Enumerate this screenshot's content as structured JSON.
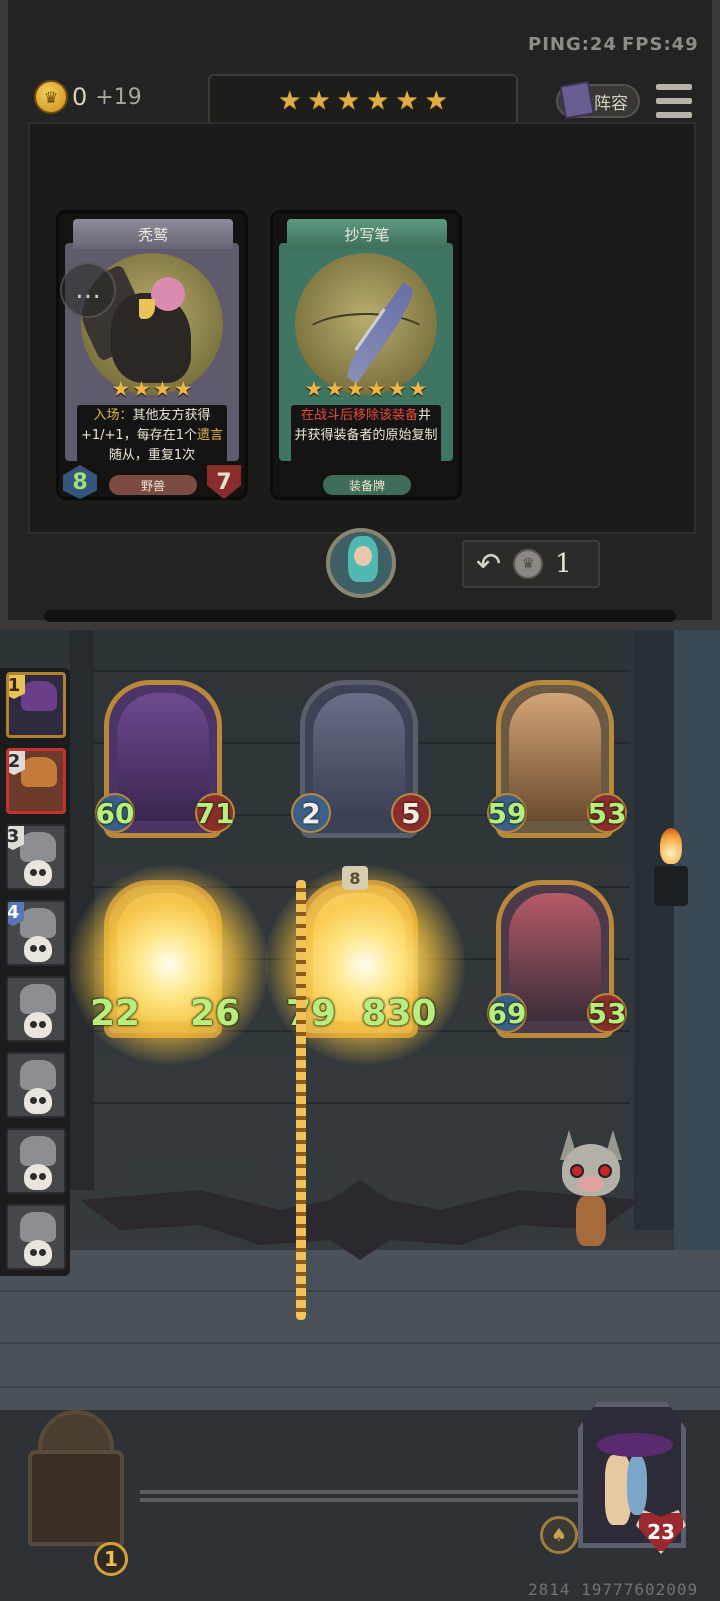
{
  "status": {
    "ping": "PING:24",
    "fps": "FPS:49"
  },
  "gold": {
    "value": "0",
    "income": "+19"
  },
  "tier": {
    "star_count": 6,
    "star_glyph": "★"
  },
  "header": {
    "lineup_label": "阵容"
  },
  "shop_cards": [
    {
      "name": "秃鹫",
      "stars": 4,
      "text_parts": [
        "入场：",
        "其他友方获得",
        "+1/+1，每存在1个",
        "遗言",
        "随从，重复1次"
      ],
      "tag": "野兽",
      "attack": "8",
      "health": "7"
    },
    {
      "name": "抄写笔",
      "stars": 6,
      "text_parts": [
        "在战斗后移除该装备",
        "并获得装备者的原始复制"
      ],
      "tag": "装备牌"
    }
  ],
  "refresh": {
    "cost": "1",
    "icon": "undo-arrow-icon"
  },
  "team_slots": [
    {
      "num": "1",
      "state": "gold"
    },
    {
      "num": "2",
      "state": "red"
    },
    {
      "num": "3",
      "state": "dead"
    },
    {
      "num": "4",
      "state": "dead"
    },
    {
      "num": "",
      "state": "dead"
    },
    {
      "num": "",
      "state": "dead"
    },
    {
      "num": "",
      "state": "dead"
    },
    {
      "num": "",
      "state": "dead"
    }
  ],
  "board": {
    "top": [
      {
        "attack": "60",
        "health": "71"
      },
      {
        "attack": "2",
        "health": "5"
      },
      {
        "attack": "59",
        "health": "53"
      }
    ],
    "bottom": [
      {
        "attack": "22",
        "health": "26"
      },
      {
        "attack": "79",
        "health": "830",
        "badge": "8"
      },
      {
        "attack": "69",
        "health": "53"
      }
    ]
  },
  "hud": {
    "chest_count": "1",
    "hero_health": "23",
    "game_id": "2814 19777602009"
  },
  "colors": {
    "gold_accent": "#e2ad43",
    "attack_green": "#b9ee7e",
    "health_red": "#8b2d2d"
  }
}
